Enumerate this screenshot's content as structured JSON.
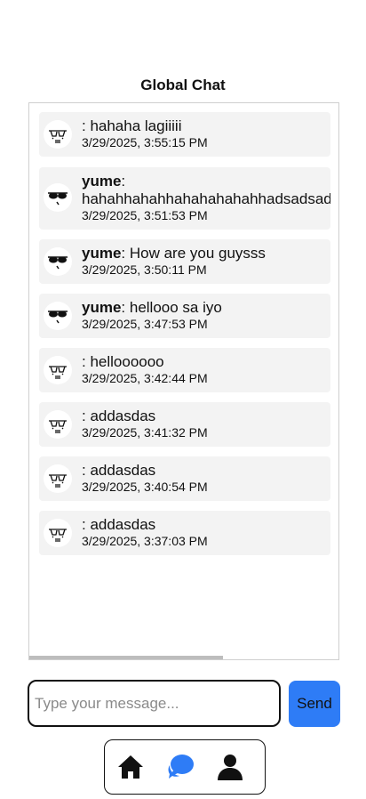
{
  "page_title": "Global Chat",
  "messages": [
    {
      "user": "",
      "text": ": hahaha lagiiiii",
      "time": "3/29/2025, 3:55:15 PM",
      "avatar": "sketch-face-avatar-icon"
    },
    {
      "user": "yume",
      "text": ":",
      "text2": "hahahhahahhahahahahahhadsadsad",
      "time": "3/29/2025, 3:51:53 PM",
      "avatar": "sunglasses-face-avatar-icon"
    },
    {
      "user": "yume",
      "text": ": How are you guysss",
      "time": "3/29/2025, 3:50:11 PM",
      "avatar": "sunglasses-face-avatar-icon"
    },
    {
      "user": "yume",
      "text": ": hellooo sa iyo",
      "time": "3/29/2025, 3:47:53 PM",
      "avatar": "sunglasses-face-avatar-icon"
    },
    {
      "user": "",
      "text": ": helloooooo",
      "time": "3/29/2025, 3:42:44 PM",
      "avatar": "sketch-face-avatar-icon"
    },
    {
      "user": "",
      "text": ": addasdas",
      "time": "3/29/2025, 3:41:32 PM",
      "avatar": "sketch-face-avatar-icon"
    },
    {
      "user": "",
      "text": ": addasdas",
      "time": "3/29/2025, 3:40:54 PM",
      "avatar": "sketch-face-avatar-icon"
    },
    {
      "user": "",
      "text": ": addasdas",
      "time": "3/29/2025, 3:37:03 PM",
      "avatar": "sketch-face-avatar-icon"
    }
  ],
  "composer": {
    "placeholder": "Type your message...",
    "value": "",
    "send_label": "Send"
  },
  "nav": {
    "items": [
      {
        "name": "home",
        "icon": "home-icon"
      },
      {
        "name": "chat",
        "icon": "chat-bubbles-icon",
        "active": true
      },
      {
        "name": "profile",
        "icon": "user-icon"
      }
    ]
  },
  "colors": {
    "accent": "#2e7cf6",
    "message_bg": "#f3f3f3",
    "border": "#cfcfcf"
  }
}
